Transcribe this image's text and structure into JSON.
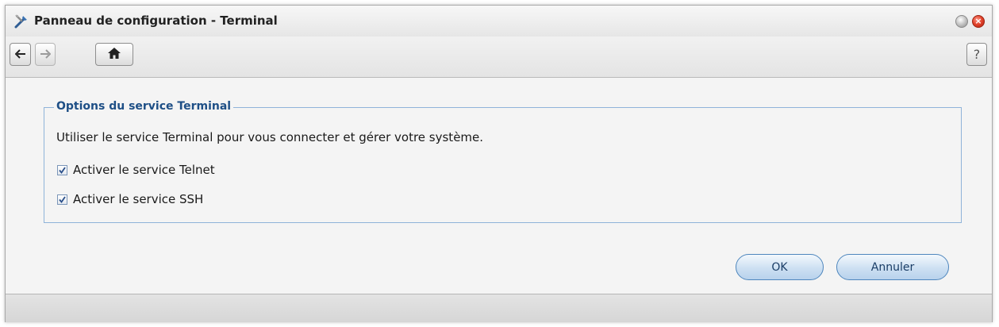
{
  "window": {
    "title": "Panneau de configuration - Terminal",
    "icon": "tools-icon",
    "minimize_icon": "minimize-icon",
    "close_icon": "close-icon"
  },
  "toolbar": {
    "back_icon": "arrow-left-icon",
    "forward_icon": "arrow-right-icon",
    "home_icon": "home-icon",
    "help_label": "?"
  },
  "terminal_options": {
    "legend": "Options du service Terminal",
    "description": "Utiliser le service Terminal pour vous connecter et gérer votre système.",
    "telnet": {
      "label": "Activer le service Telnet",
      "checked": true
    },
    "ssh": {
      "label": "Activer le service SSH",
      "checked": true
    }
  },
  "buttons": {
    "ok_label": "OK",
    "cancel_label": "Annuler"
  },
  "colors": {
    "legend": "#1e4f86",
    "fieldset_border": "#8fb3d9",
    "button_border": "#4e86bd"
  }
}
